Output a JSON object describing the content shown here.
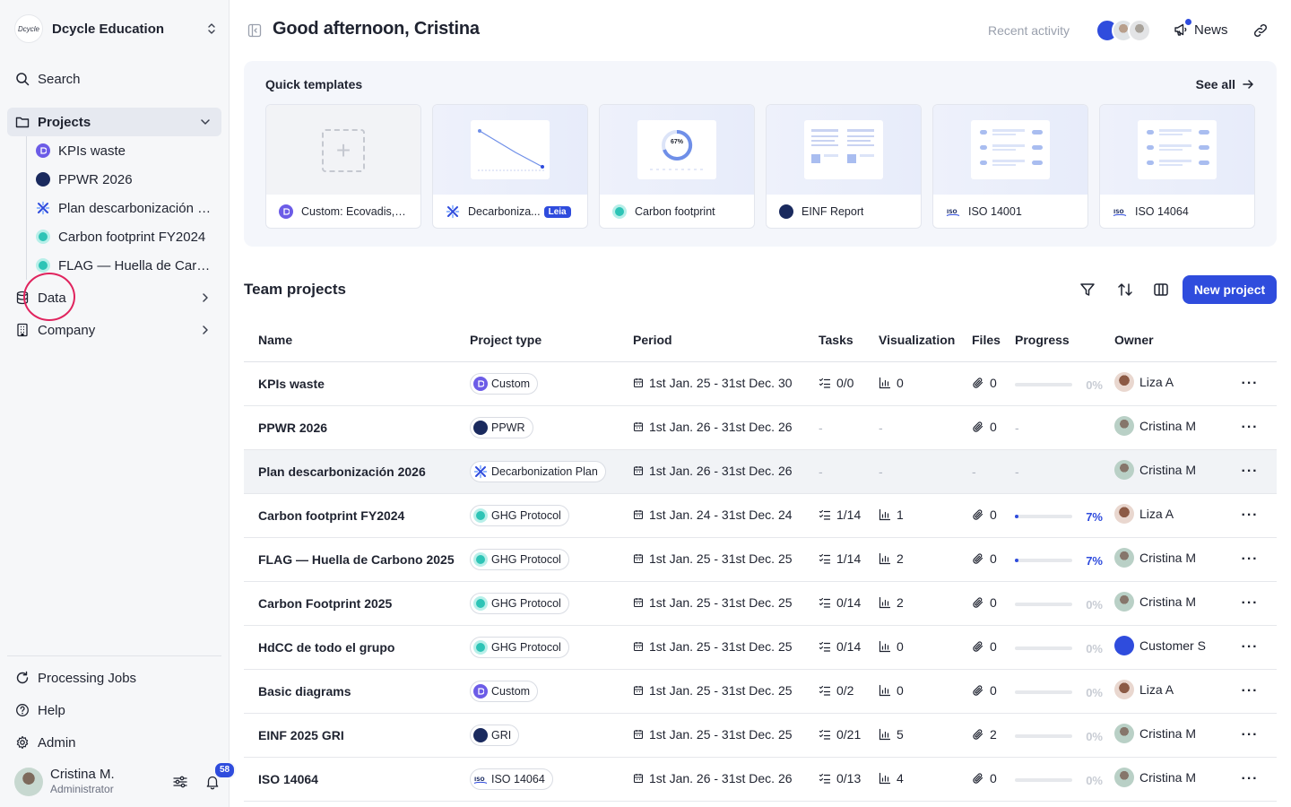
{
  "org": {
    "logo_text": "Dcycle",
    "name": "Dcycle Education"
  },
  "sidebar": {
    "search": "Search",
    "projects": "Projects",
    "project_items": [
      "KPIs waste",
      "PPWR 2026",
      "Plan descarbonización 2026",
      "Carbon footprint FY2024",
      "FLAG — Huella de Carbono 2025"
    ],
    "data": "Data",
    "company": "Company",
    "processing_jobs": "Processing Jobs",
    "help": "Help",
    "admin": "Admin"
  },
  "user": {
    "name": "Cristina M.",
    "role": "Administrator",
    "notifications": "58"
  },
  "header": {
    "greeting": "Good afternoon, Cristina",
    "recent_activity": "Recent activity",
    "news": "News"
  },
  "quick_templates": {
    "title": "Quick templates",
    "see_all": "See all",
    "items": [
      {
        "label": "Custom: Ecovadis, ...",
        "icon": "custom-icon"
      },
      {
        "label": "Decarboniza...",
        "icon": "decarbonization-icon",
        "tag": "Leia"
      },
      {
        "label": "Carbon footprint",
        "icon": "ghg-icon",
        "thumb_text": "67%"
      },
      {
        "label": "EINF Report",
        "icon": "einf-icon"
      },
      {
        "label": "ISO 14001",
        "icon": "iso-icon"
      },
      {
        "label": "ISO 14064",
        "icon": "iso-icon"
      }
    ]
  },
  "team_projects": {
    "title": "Team projects",
    "new_project": "New project",
    "columns": [
      "Name",
      "Project type",
      "Period",
      "Tasks",
      "Visualization",
      "Files",
      "Progress",
      "Owner"
    ],
    "rows": [
      {
        "name": "KPIs waste",
        "type": "Custom",
        "period": "1st Jan. 25 - 31st Dec. 30",
        "tasks": "0/0",
        "vis": "0",
        "files": "0",
        "progress": "0%",
        "progress_value": 0,
        "owner": "Liza A"
      },
      {
        "name": "PPWR 2026",
        "type": "PPWR",
        "period": "1st Jan. 26 - 31st Dec. 26",
        "tasks": "-",
        "vis": "-",
        "files": "0",
        "progress": "-",
        "progress_value": null,
        "owner": "Cristina M"
      },
      {
        "name": "Plan descarbonización 2026",
        "type": "Decarbonization Plan",
        "period": "1st Jan. 26 - 31st Dec. 26",
        "tasks": "-",
        "vis": "-",
        "files": "-",
        "progress": "-",
        "progress_value": null,
        "owner": "Cristina M"
      },
      {
        "name": "Carbon footprint FY2024",
        "type": "GHG Protocol",
        "period": "1st Jan. 24 - 31st Dec. 24",
        "tasks": "1/14",
        "vis": "1",
        "files": "0",
        "progress": "7%",
        "progress_value": 0.07,
        "owner": "Liza A"
      },
      {
        "name": "FLAG — Huella de Carbono 2025",
        "type": "GHG Protocol",
        "period": "1st Jan. 25 - 31st Dec. 25",
        "tasks": "1/14",
        "vis": "2",
        "files": "0",
        "progress": "7%",
        "progress_value": 0.07,
        "owner": "Cristina M"
      },
      {
        "name": "Carbon Footprint 2025",
        "type": "GHG Protocol",
        "period": "1st Jan. 25 - 31st Dec. 25",
        "tasks": "0/14",
        "vis": "2",
        "files": "0",
        "progress": "0%",
        "progress_value": 0,
        "owner": "Cristina M"
      },
      {
        "name": "HdCC de todo el grupo",
        "type": "GHG Protocol",
        "period": "1st Jan. 25 - 31st Dec. 25",
        "tasks": "0/14",
        "vis": "0",
        "files": "0",
        "progress": "0%",
        "progress_value": 0,
        "owner": "Customer S"
      },
      {
        "name": "Basic diagrams",
        "type": "Custom",
        "period": "1st Jan. 25 - 31st Dec. 25",
        "tasks": "0/2",
        "vis": "0",
        "files": "0",
        "progress": "0%",
        "progress_value": 0,
        "owner": "Liza A"
      },
      {
        "name": "EINF 2025 GRI",
        "type": "GRI",
        "period": "1st Jan. 25 - 31st Dec. 25",
        "tasks": "0/21",
        "vis": "5",
        "files": "2",
        "progress": "0%",
        "progress_value": 0,
        "owner": "Cristina M"
      },
      {
        "name": "ISO 14064",
        "type": "ISO 14064",
        "period": "1st Jan. 26 - 31st Dec. 26",
        "tasks": "0/13",
        "vis": "4",
        "files": "0",
        "progress": "0%",
        "progress_value": 0,
        "owner": "Cristina M"
      }
    ]
  },
  "colors": {
    "accent": "#2f4cdd",
    "highlight_circle": "#e0245e",
    "sidebar_bg": "#f6f7f9"
  }
}
